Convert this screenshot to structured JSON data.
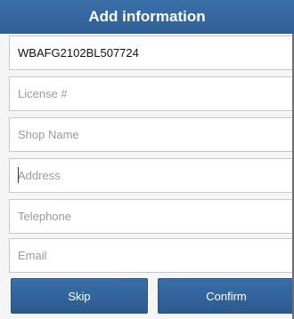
{
  "dialog": {
    "title": "Add information",
    "fields": {
      "vin": {
        "value": "WBAFG2102BL507724",
        "placeholder": ""
      },
      "license": {
        "value": "",
        "placeholder": "License #"
      },
      "shop_name": {
        "value": "",
        "placeholder": "Shop Name"
      },
      "address": {
        "value": "",
        "placeholder": "Address"
      },
      "telephone": {
        "value": "",
        "placeholder": "Telephone"
      },
      "email": {
        "value": "",
        "placeholder": "Email"
      }
    },
    "buttons": {
      "skip": "Skip",
      "confirm": "Confirm"
    },
    "colors": {
      "header": "#2f5f96",
      "button": "#2f5f96"
    }
  }
}
